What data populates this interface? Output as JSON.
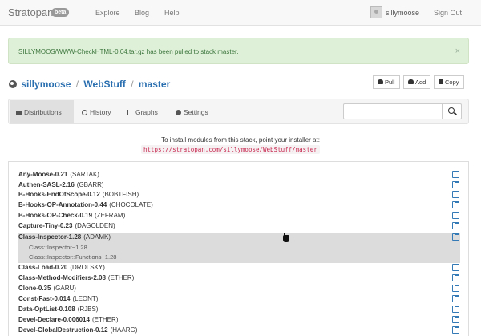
{
  "nav": {
    "brand": "Stratopan",
    "badge": "beta",
    "links": [
      "Explore",
      "Blog",
      "Help"
    ],
    "username": "sillymoose",
    "signout": "Sign Out"
  },
  "alert": {
    "message": "SILLYMOOS/WWW-CheckHTML-0.04.tar.gz has been pulled to stack master.",
    "close": "×"
  },
  "breadcrumb": {
    "user": "sillymoose",
    "repo": "WebStuff",
    "stack": "master",
    "separator": "/"
  },
  "actions": {
    "pull": "Pull",
    "add": "Add",
    "copy": "Copy"
  },
  "tabs": [
    "Distributions",
    "History",
    "Graphs",
    "Settings"
  ],
  "search": {
    "placeholder": ""
  },
  "install": {
    "text": "To install modules from this stack, point your installer at:",
    "url": "https://stratopan.com/sillymoose/WebStuff/master"
  },
  "distributions": [
    {
      "name": "Any-Moose-0.21",
      "author": "(SARTAK)"
    },
    {
      "name": "Authen-SASL-2.16",
      "author": "(GBARR)"
    },
    {
      "name": "B-Hooks-EndOfScope-0.12",
      "author": "(BOBTFISH)"
    },
    {
      "name": "B-Hooks-OP-Annotation-0.44",
      "author": "(CHOCOLATE)"
    },
    {
      "name": "B-Hooks-OP-Check-0.19",
      "author": "(ZEFRAM)"
    },
    {
      "name": "Capture-Tiny-0.23",
      "author": "(DAGOLDEN)"
    },
    {
      "name": "Class-Inspector-1.28",
      "author": "(ADAMK)"
    },
    {
      "name": "Class-Load-0.20",
      "author": "(DROLSKY)"
    },
    {
      "name": "Class-Method-Modifiers-2.08",
      "author": "(ETHER)"
    },
    {
      "name": "Clone-0.35",
      "author": "(GARU)"
    },
    {
      "name": "Const-Fast-0.014",
      "author": "(LEONT)"
    },
    {
      "name": "Data-OptList-0.108",
      "author": "(RJBS)"
    },
    {
      "name": "Devel-Declare-0.006014",
      "author": "(ETHER)"
    },
    {
      "name": "Devel-GlobalDestruction-0.12",
      "author": "(HAARG)"
    }
  ],
  "expanded_packages": [
    "Class::Inspector~1.28",
    "Class::Inspector::Functions~1.28"
  ]
}
